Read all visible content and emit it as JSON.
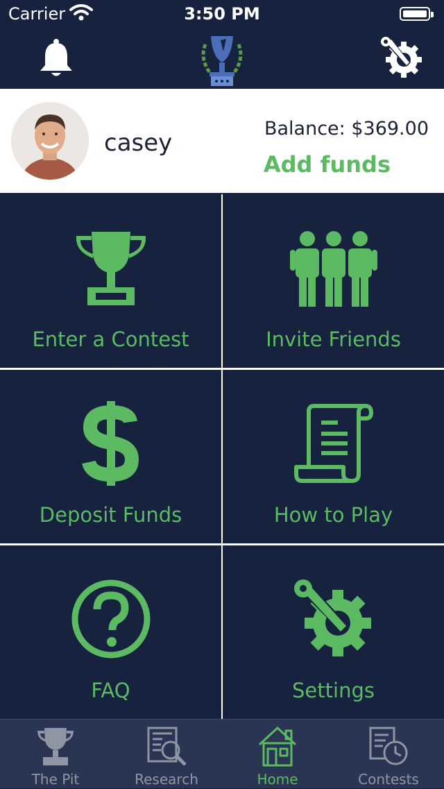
{
  "status_bar": {
    "carrier": "Carrier",
    "time": "3:50 PM"
  },
  "nav": {
    "left_icon": "bell-icon",
    "center_icon": "trophy-logo",
    "right_icon": "settings-gear-icon"
  },
  "profile": {
    "username": "casey",
    "balance": "Balance: $369.00",
    "add_funds": "Add funds"
  },
  "tiles": [
    {
      "label": "Enter a Contest",
      "icon": "trophy-icon"
    },
    {
      "label": "Invite Friends",
      "icon": "people-icon"
    },
    {
      "label": "Deposit Funds",
      "icon": "dollar-icon"
    },
    {
      "label": "How to Play",
      "icon": "scroll-icon"
    },
    {
      "label": "FAQ",
      "icon": "question-icon"
    },
    {
      "label": "Settings",
      "icon": "settings-gear-icon"
    }
  ],
  "tabs": [
    {
      "label": "The Pit",
      "icon": "trophy-icon",
      "active": false
    },
    {
      "label": "Research",
      "icon": "research-icon",
      "active": false
    },
    {
      "label": "Home",
      "icon": "home-icon",
      "active": true
    },
    {
      "label": "Contests",
      "icon": "contests-icon",
      "active": false
    }
  ],
  "colors": {
    "navy": "#17223f",
    "accent_green": "#5cbb62",
    "tab_bar": "#2a3553",
    "inactive_gray": "#8f96a3"
  }
}
